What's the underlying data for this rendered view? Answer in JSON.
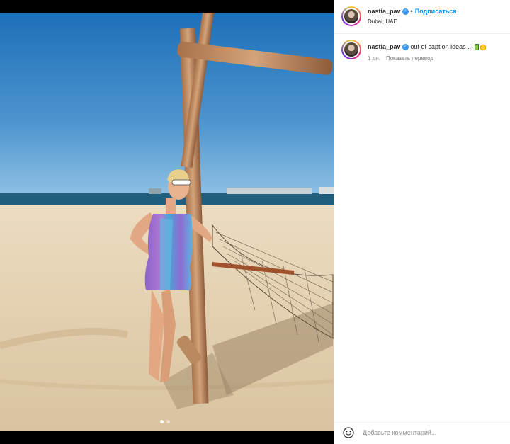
{
  "post": {
    "username": "nastia_pav",
    "follow_label": "Подписаться",
    "location": "Dubai, UAE",
    "separator": "•"
  },
  "caption": {
    "username": "nastia_pav",
    "text": "out of caption ideas ...",
    "emoji": [
      "battery-icon",
      "sun-icon"
    ],
    "time": "1 дн.",
    "translate_label": "Показать перевод"
  },
  "comment": {
    "placeholder": "Добавьте комментарий...",
    "emoji_icon": "smile-icon"
  },
  "carousel": {
    "count": 2,
    "active": 1
  },
  "colors": {
    "accent": "#0095f6",
    "verified": "#3897f0",
    "text": "#262626",
    "muted": "#8e8e8e"
  }
}
